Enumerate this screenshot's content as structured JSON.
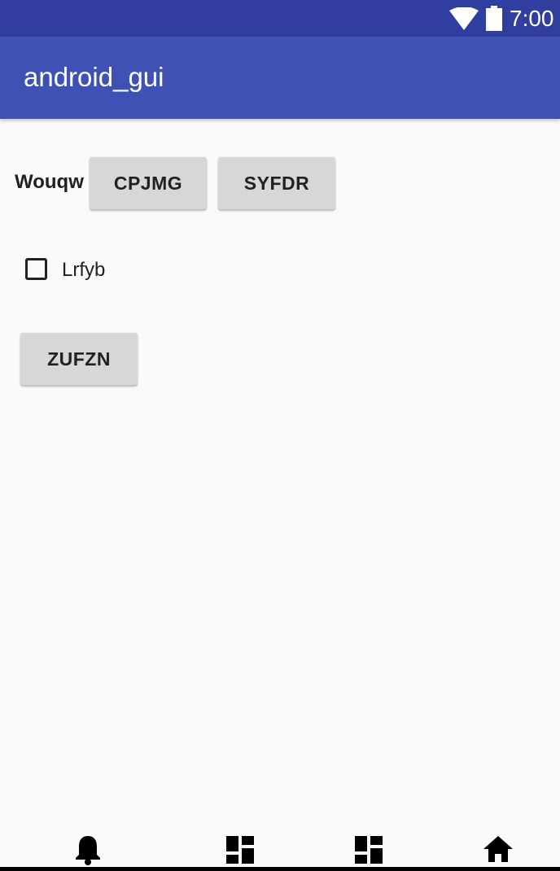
{
  "status_bar": {
    "time": "7:00",
    "wifi_icon": "wifi-icon",
    "battery_icon": "battery-icon"
  },
  "app_bar": {
    "title": "android_gui"
  },
  "main": {
    "row_label": "Wouqw",
    "buttons": [
      "CPJMG",
      "SYFDR"
    ],
    "checkbox": {
      "label": "Lrfyb",
      "checked": false
    },
    "bottom_button": "ZUFZN"
  },
  "bottom_nav": {
    "icons": [
      "bell-icon",
      "dashboard-icon",
      "dashboard-icon",
      "home-icon"
    ]
  },
  "colors": {
    "status_bar": "#303f9f",
    "app_bar": "#3f51b5",
    "background": "#fafafa",
    "button": "#d6d7d7"
  }
}
